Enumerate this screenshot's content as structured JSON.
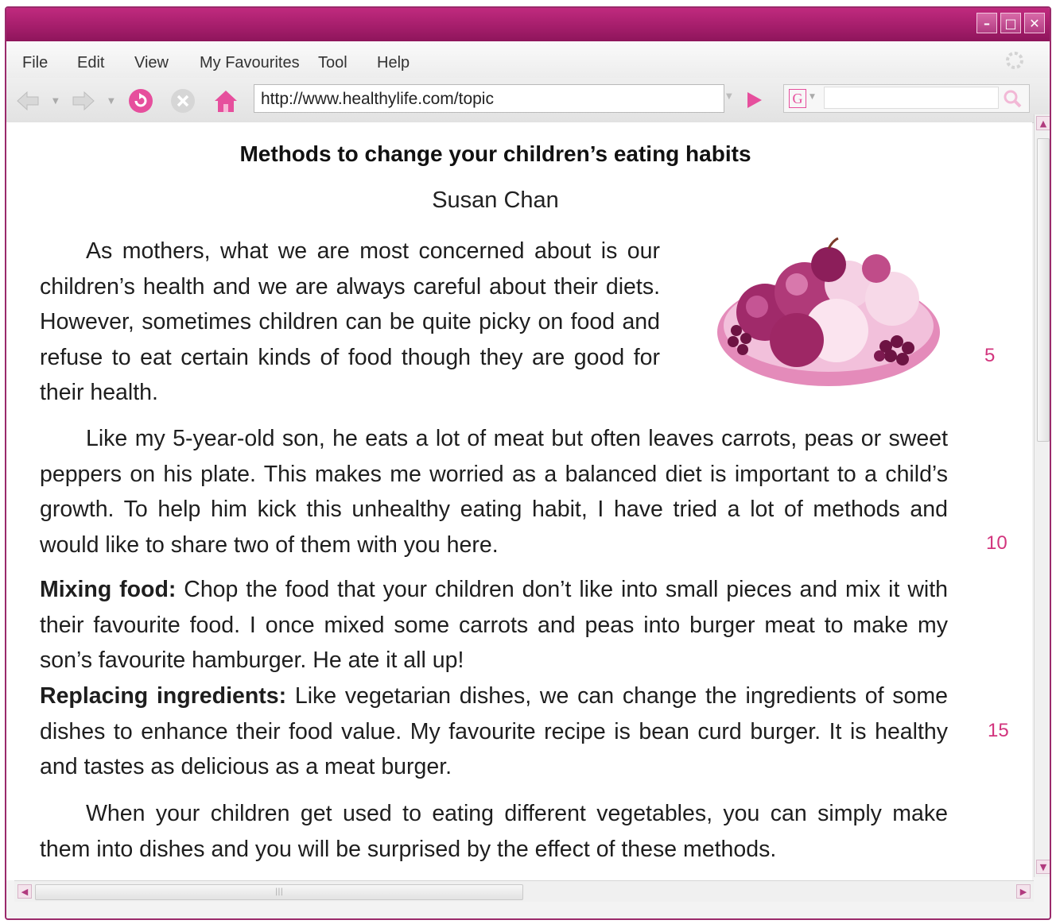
{
  "browser": {
    "menu": [
      "File",
      "Edit",
      "View",
      "My Favourites",
      "Tool",
      "Help"
    ],
    "url": "http://www.healthylife.com/topic",
    "search_logo": "G",
    "window_controls": [
      "minimize-icon",
      "maximize-icon",
      "close-icon"
    ],
    "accent_color": "#a8226f"
  },
  "article": {
    "title": "Methods to change your children’s eating habits",
    "author": "Susan Chan",
    "p1": "As mothers, what we are most concerned about is our children’s health and we are always careful about their diets. However, sometimes children can be quite picky on food and refuse to eat certain kinds of food though they are good for their health.",
    "p2": "Like my 5-year-old son, he eats a lot of meat but often leaves carrots, peas or sweet peppers on his plate. This makes me worried as a balanced diet is important to a child’s growth. To help him kick this unhealthy eating habit, I have tried a lot of methods and would like to share two of them with you here.",
    "method1_label": "Mixing food:",
    "method1_text": " Chop the food that your children don’t like into small pieces and mix it with their favourite food. I once mixed some carrots and peas into burger meat to make my son’s favourite hamburger. He ate it all up!",
    "method2_label": "Replacing ingredients:",
    "method2_text": " Like vegetarian dishes, we can change the ingredients of some dishes to enhance their food value. My favourite recipe is bean curd burger. It is healthy and tastes as delicious as a meat burger.",
    "p_last": "When your children get used to eating different vegetables, you can simply make them into dishes and you will be surprised by the effect of these methods.",
    "line_numbers": [
      "5",
      "10",
      "15"
    ],
    "image": "fruit-bowl-image"
  }
}
